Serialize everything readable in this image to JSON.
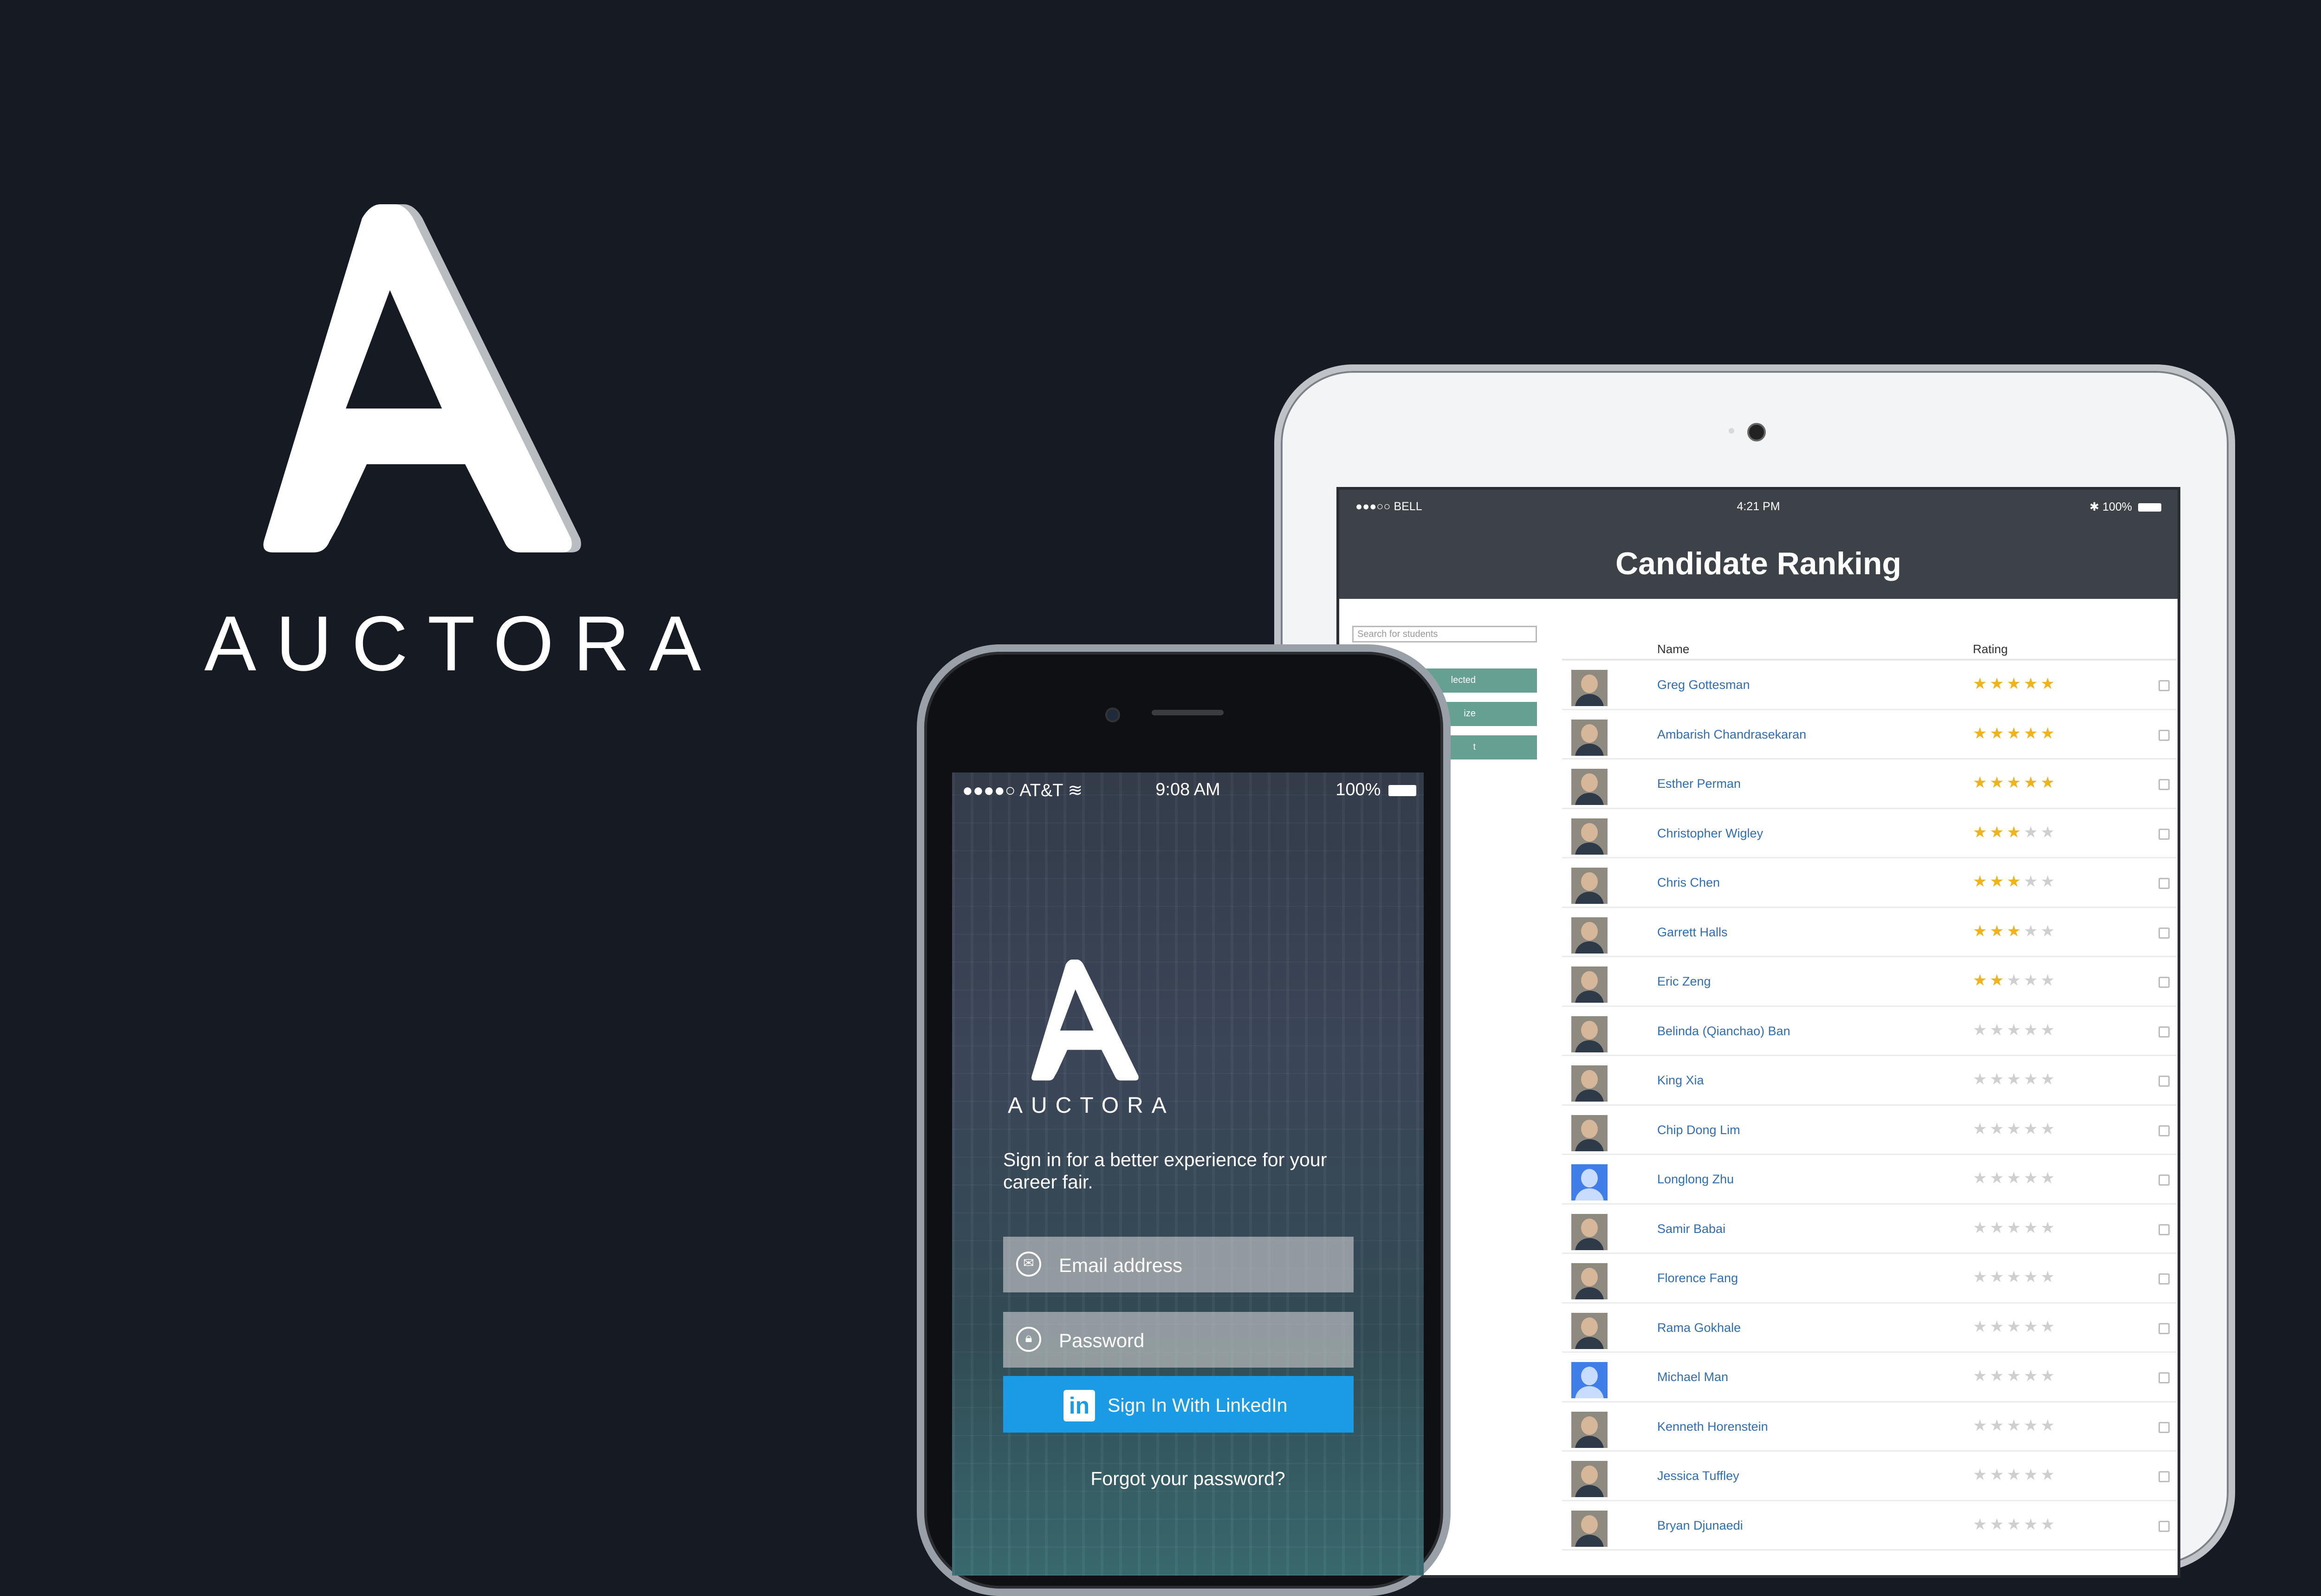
{
  "brand": {
    "name": "AUCTORA"
  },
  "ipad": {
    "status": {
      "carrier": "●●●○○ BELL",
      "time": "4:21 PM",
      "battery": "100%"
    },
    "title": "Candidate Ranking",
    "search_placeholder": "Search for students",
    "side_buttons": [
      "lected",
      "ize",
      "t"
    ],
    "table": {
      "headers": {
        "name": "Name",
        "rating": "Rating"
      },
      "rows": [
        {
          "name": "Greg Gottesman",
          "stars": "★★★★★",
          "empty": ""
        },
        {
          "name": "Ambarish Chandrasekaran",
          "stars": "★★★★★",
          "empty": ""
        },
        {
          "name": "Esther Perman",
          "stars": "★★★★★",
          "empty": ""
        },
        {
          "name": "Christopher Wigley",
          "stars": "★★★",
          "empty": "★★"
        },
        {
          "name": "Chris Chen",
          "stars": "★★★",
          "empty": "★★"
        },
        {
          "name": "Garrett Halls",
          "stars": "★★★",
          "empty": "★★"
        },
        {
          "name": "Eric Zeng",
          "stars": "★★",
          "empty": "★★★"
        },
        {
          "name": "Belinda (Qianchao) Ban",
          "stars": "",
          "empty": "★★★★★"
        },
        {
          "name": "King Xia",
          "stars": "",
          "empty": "★★★★★"
        },
        {
          "name": "Chip Dong Lim",
          "stars": "",
          "empty": "★★★★★"
        },
        {
          "name": "Longlong Zhu",
          "stars": "",
          "empty": "★★★★★"
        },
        {
          "name": "Samir Babai",
          "stars": "",
          "empty": "★★★★★"
        },
        {
          "name": "Florence Fang",
          "stars": "",
          "empty": "★★★★★"
        },
        {
          "name": "Rama Gokhale",
          "stars": "",
          "empty": "★★★★★"
        },
        {
          "name": "Michael Man",
          "stars": "",
          "empty": "★★★★★"
        },
        {
          "name": "Kenneth Horenstein",
          "stars": "",
          "empty": "★★★★★"
        },
        {
          "name": "Jessica Tuffley",
          "stars": "",
          "empty": "★★★★★"
        },
        {
          "name": "Bryan Djunaedi",
          "stars": "",
          "empty": "★★★★★"
        }
      ]
    }
  },
  "iphone": {
    "status": {
      "carrier": "●●●●○ AT&T",
      "time": "9:08 AM",
      "battery": "100%"
    },
    "brand": "AUCTORA",
    "tagline": "Sign in for a better experience for your career fair.",
    "email_placeholder": "Email address",
    "password_placeholder": "Password",
    "linkedin_button": "Sign In With LinkedIn",
    "forgot_link": "Forgot your password?"
  },
  "colors": {
    "background": "#151a23",
    "ipad_header": "#3d4248",
    "accent_green": "#65a093",
    "link_blue": "#2f6eb5",
    "star_gold": "#f0b31b",
    "linkedin_blue": "#1a9be4"
  },
  "icons": [
    "brand-a-icon",
    "wifi-icon",
    "bluetooth-icon",
    "battery-icon",
    "envelope-icon",
    "lock-icon",
    "linkedin-icon",
    "avatar-icon"
  ]
}
